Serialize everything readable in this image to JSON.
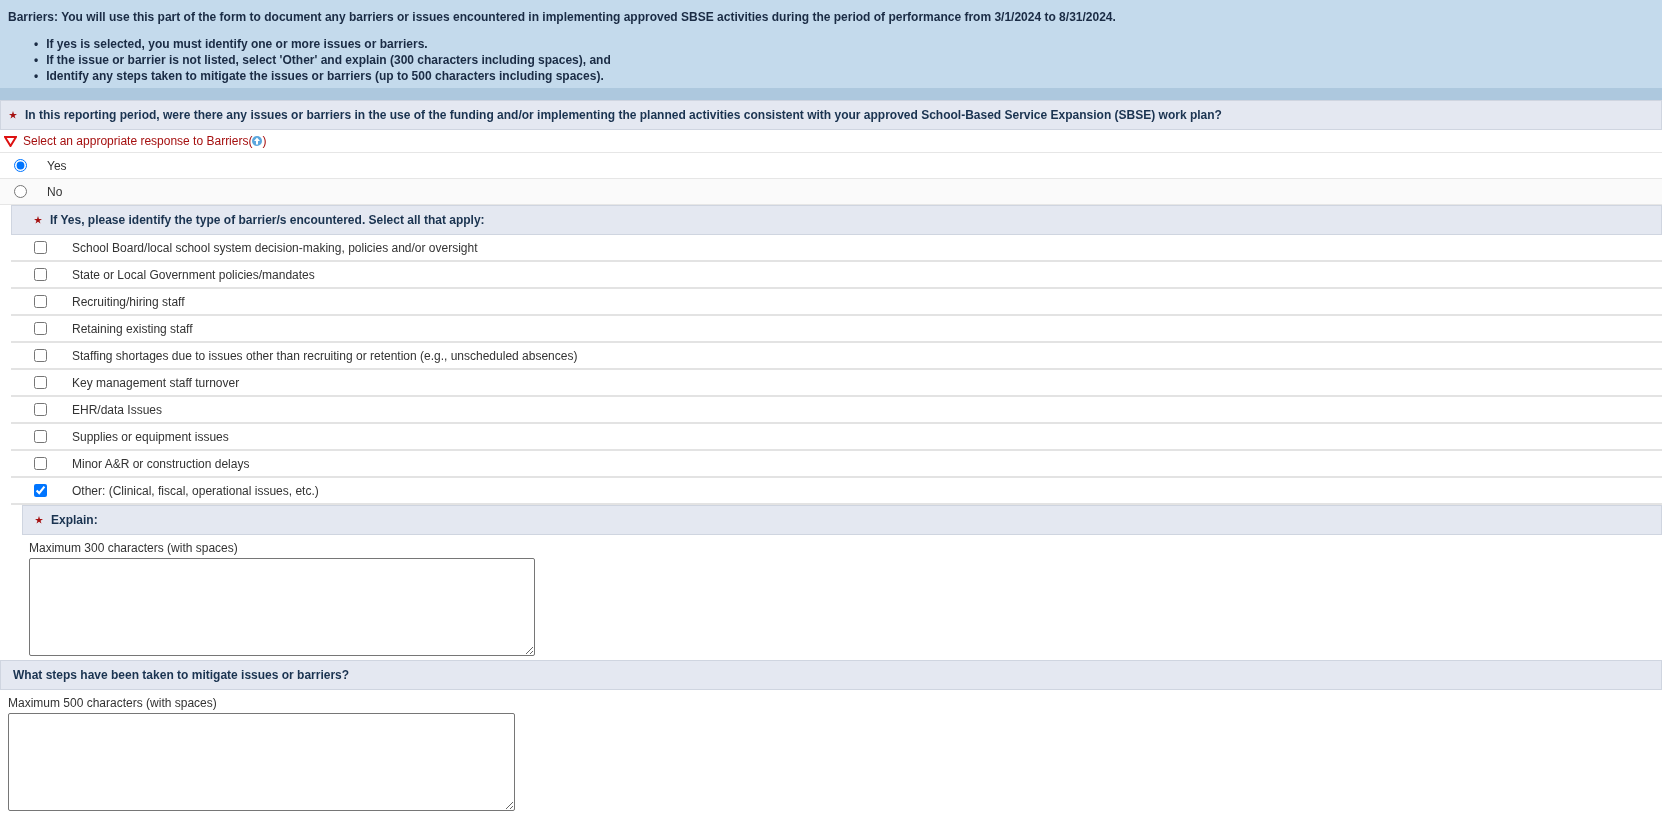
{
  "intro": {
    "text": "Barriers: You will use this part of the form to document any barriers or issues encountered in implementing approved SBSE activities during the period of performance from 3/1/2024 to 8/31/2024.",
    "marker": "•",
    "bullets": [
      "If yes is selected, you must identify one or more issues or barriers.",
      "If the issue or barrier is not listed, select 'Other' and explain (300 characters including spaces), and",
      "Identify any steps taken to mitigate the issues or barriers (up to 500 characters including spaces)."
    ]
  },
  "question": {
    "required": true,
    "text": "In this reporting period, were there any issues or barriers in the use of the funding and/or implementing the planned activities consistent with your approved School-Based Service Expansion (SBSE) work plan?"
  },
  "validation": {
    "message": "Select an appropriate response to Barriers(",
    "close": ")"
  },
  "options": [
    {
      "label": "Yes",
      "selected": true
    },
    {
      "label": "No",
      "selected": false
    }
  ],
  "barrier_types": {
    "required": true,
    "heading": "If Yes, please identify the type of barrier/s encountered. Select all that apply:",
    "items": [
      {
        "label": "School Board/local school system decision-making, policies and/or oversight",
        "checked": false
      },
      {
        "label": "State or Local Government policies/mandates",
        "checked": false
      },
      {
        "label": "Recruiting/hiring staff",
        "checked": false
      },
      {
        "label": "Retaining existing staff",
        "checked": false
      },
      {
        "label": "Staffing shortages due to issues other than recruiting or retention (e.g., unscheduled absences)",
        "checked": false
      },
      {
        "label": "Key management staff turnover",
        "checked": false
      },
      {
        "label": "EHR/data Issues",
        "checked": false
      },
      {
        "label": "Supplies or equipment issues",
        "checked": false
      },
      {
        "label": "Minor A&R or construction delays",
        "checked": false
      },
      {
        "label": "Other: (Clinical, fiscal, operational issues, etc.)",
        "checked": true
      }
    ]
  },
  "explain": {
    "required": true,
    "heading": "Explain:",
    "hint": "Maximum 300 characters (with spaces)"
  },
  "mitigation": {
    "required": false,
    "heading": "What steps have been taken to mitigate issues or barriers?",
    "hint": "Maximum 500 characters (with spaces)"
  }
}
